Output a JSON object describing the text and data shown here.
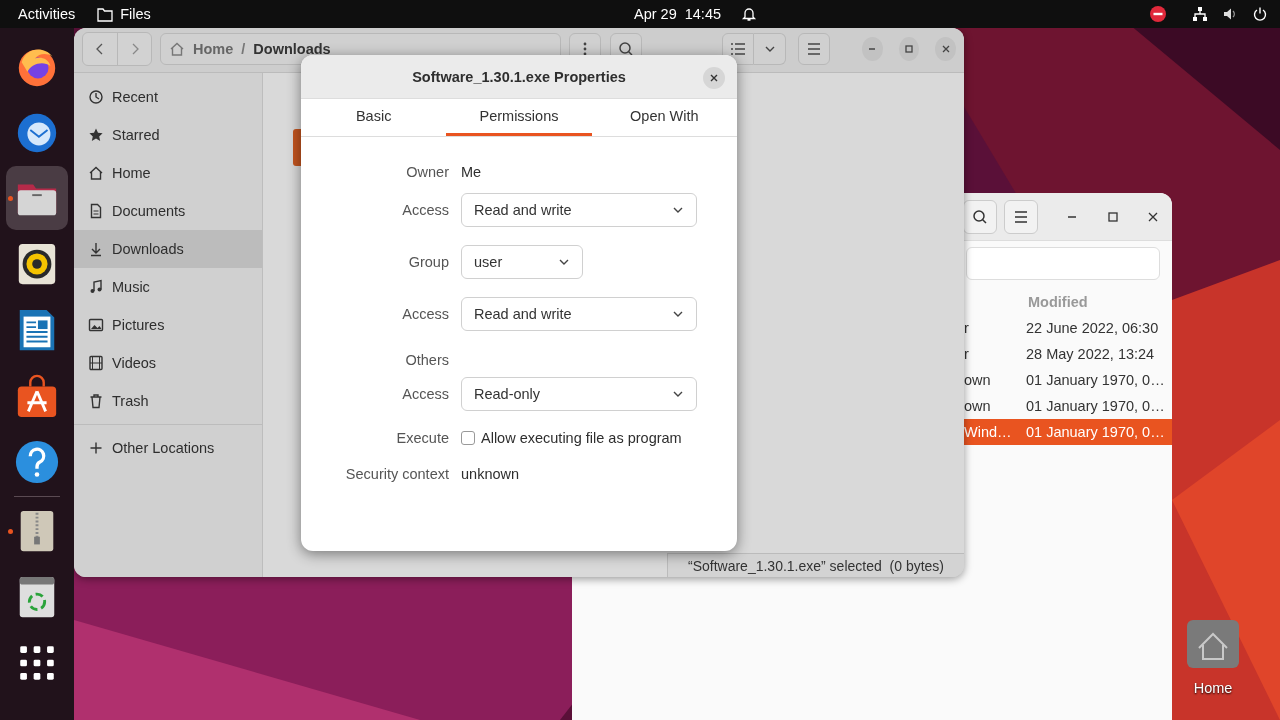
{
  "top_bar": {
    "activities": "Activities",
    "app_name": "Files",
    "date": "Apr 29",
    "time": "14:45"
  },
  "dock": [
    {
      "kind": "firefox",
      "running": false,
      "selected": false
    },
    {
      "kind": "thunderbird",
      "running": false,
      "selected": false
    },
    {
      "kind": "files",
      "running": true,
      "selected": true
    },
    {
      "kind": "rhythmbox",
      "running": false,
      "selected": false
    },
    {
      "kind": "writer",
      "running": false,
      "selected": false
    },
    {
      "kind": "appcenter",
      "running": false,
      "selected": false
    },
    {
      "kind": "help",
      "running": false,
      "selected": false
    },
    {
      "kind": "separator"
    },
    {
      "kind": "archive",
      "running": true,
      "selected": false
    },
    {
      "kind": "trash",
      "running": false,
      "selected": false
    },
    {
      "kind": "apps",
      "running": false,
      "selected": false
    }
  ],
  "files_window": {
    "path": [
      "Home",
      "Downloads"
    ],
    "path_separator": "/",
    "sidebar": [
      {
        "kind": "recent",
        "label": "Recent",
        "selected": false
      },
      {
        "kind": "starred",
        "label": "Starred",
        "selected": false
      },
      {
        "kind": "home",
        "label": "Home",
        "selected": false
      },
      {
        "kind": "documents",
        "label": "Documents",
        "selected": false
      },
      {
        "kind": "downloads",
        "label": "Downloads",
        "selected": true
      },
      {
        "kind": "music",
        "label": "Music",
        "selected": false
      },
      {
        "kind": "pictures",
        "label": "Pictures",
        "selected": false
      },
      {
        "kind": "videos",
        "label": "Videos",
        "selected": false
      },
      {
        "kind": "trash",
        "label": "Trash",
        "selected": false
      },
      {
        "kind": "other",
        "label": "Other Locations",
        "selected": false
      }
    ],
    "status": "“Software_1.30.1.exe” selected  (0 bytes)"
  },
  "properties_dialog": {
    "title": "Software_1.30.1.exe Properties",
    "tabs": [
      {
        "label": "Basic",
        "selected": false
      },
      {
        "label": "Permissions",
        "selected": true
      },
      {
        "label": "Open With",
        "selected": false
      }
    ],
    "rows": [
      {
        "kind": "text",
        "label": "Owner",
        "value": "Me"
      },
      {
        "kind": "dropdown",
        "label": "Access",
        "value": "Read and write"
      },
      {
        "kind": "short-dropdown",
        "label": "Group",
        "value": "user"
      },
      {
        "kind": "dropdown",
        "label": "Access",
        "value": "Read and write"
      },
      {
        "kind": "heading",
        "label": "Others"
      },
      {
        "kind": "dropdown",
        "label": "Access",
        "value": "Read-only"
      },
      {
        "kind": "checkbox",
        "label": "Execute",
        "value": "Allow executing file as program",
        "checked": false
      },
      {
        "kind": "text",
        "label": "Security context",
        "value": "unknown"
      }
    ]
  },
  "second_window": {
    "columns": [
      "Modified"
    ],
    "rows": [
      {
        "column_1": "r",
        "modified": "22 June 2022, 06:30",
        "selected": false
      },
      {
        "column_1": "r",
        "modified": "28 May 2022, 13:24",
        "selected": false
      },
      {
        "column_1": "own",
        "modified": "01 January 1970, 0…",
        "selected": false
      },
      {
        "column_1": "own",
        "modified": "01 January 1970, 0…",
        "selected": false
      },
      {
        "column_1": "Wind…",
        "modified": "01 January 1970, 0…",
        "selected": true
      }
    ]
  },
  "desktop_icons": [
    {
      "label": "Home"
    }
  ]
}
